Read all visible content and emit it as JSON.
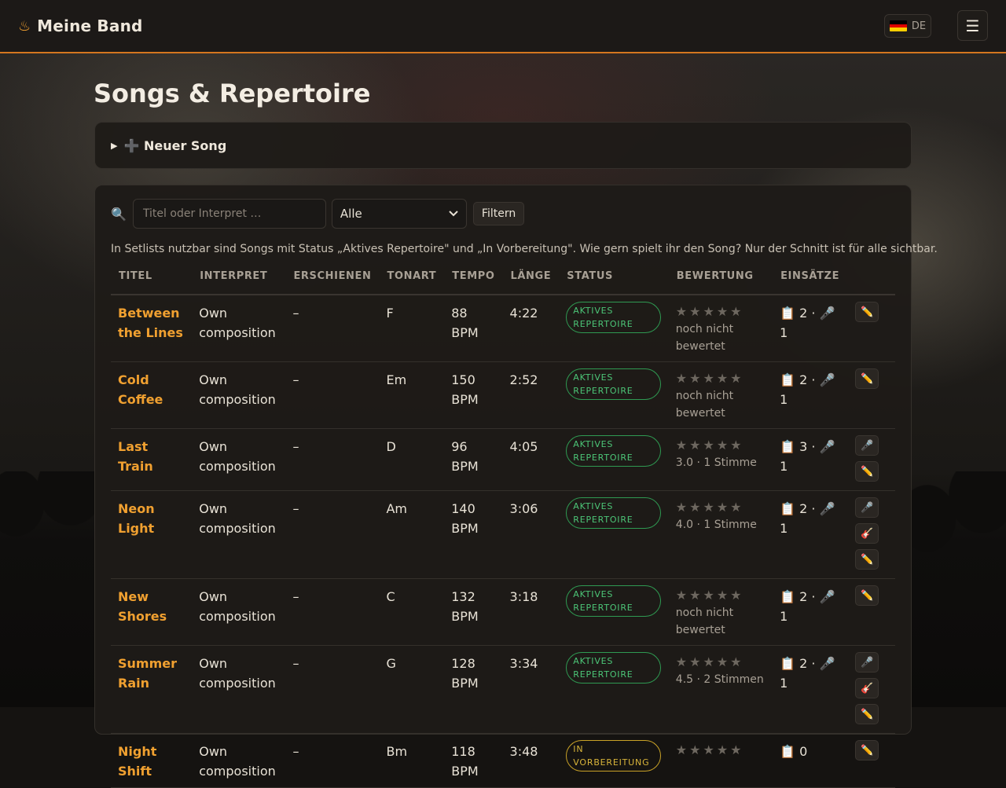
{
  "app": {
    "name": "Meine Band",
    "icon": "flame-icon"
  },
  "language": {
    "code": "DE",
    "flag_colors": [
      "#000000",
      "#dd0000",
      "#ffce00"
    ]
  },
  "menu": {
    "icon": "hamburger-icon",
    "glyph": "☰"
  },
  "page": {
    "title": "Songs & Repertoire"
  },
  "new_song": {
    "label": "➕ Neuer Song",
    "toggle": "▶"
  },
  "filter": {
    "search_placeholder": "Titel oder Interpret …",
    "status_selected": "Alle",
    "button": "Filtern"
  },
  "hint": "In Setlists nutzbar sind Songs mit Status „Aktives Repertoire\" und „In Vorbereitung\". Wie gern spielt ihr den Song? Nur der Schnitt ist für alle sichtbar.",
  "table": {
    "columns": [
      "TITEL",
      "INTERPRET",
      "ERSCHIENEN",
      "TONART",
      "TEMPO",
      "LÄNGE",
      "STATUS",
      "BEWERTUNG",
      "EINSÄTZE",
      ""
    ],
    "rows": [
      {
        "title": "Between the Lines",
        "artist": "Own composition",
        "released": "–",
        "key": "F",
        "tempo": "88 BPM",
        "length": "4:22",
        "status": "AKTIVES REPERTOIRE",
        "stars": "★★★★★",
        "rating": "noch nicht bewertet",
        "usage": "📋 2 · 🎤 1",
        "actions": [
          "✏️"
        ]
      },
      {
        "title": "Cold Coffee",
        "artist": "Own composition",
        "released": "–",
        "key": "Em",
        "tempo": "150 BPM",
        "length": "2:52",
        "status": "AKTIVES REPERTOIRE",
        "stars": "★★★★★",
        "rating": "noch nicht bewertet",
        "usage": "📋 2 · 🎤 1",
        "actions": [
          "✏️"
        ]
      },
      {
        "title": "Last Train",
        "artist": "Own composition",
        "released": "–",
        "key": "D",
        "tempo": "96 BPM",
        "length": "4:05",
        "status": "AKTIVES REPERTOIRE",
        "stars": "★★★★★",
        "rating": "3.0 · 1 Stimme",
        "usage": "📋 3 · 🎤 1",
        "actions": [
          "🎤",
          "✏️"
        ]
      },
      {
        "title": "Neon Light",
        "artist": "Own composition",
        "released": "–",
        "key": "Am",
        "tempo": "140 BPM",
        "length": "3:06",
        "status": "AKTIVES REPERTOIRE",
        "stars": "★★★★★",
        "rating": "4.0 · 1 Stimme",
        "usage": "📋 2 · 🎤 1",
        "actions": [
          "🎤",
          "🎸",
          "✏️"
        ]
      },
      {
        "title": "New Shores",
        "artist": "Own composition",
        "released": "–",
        "key": "C",
        "tempo": "132 BPM",
        "length": "3:18",
        "status": "AKTIVES REPERTOIRE",
        "stars": "★★★★★",
        "rating": "noch nicht bewertet",
        "usage": "📋 2 · 🎤 1",
        "actions": [
          "✏️"
        ]
      },
      {
        "title": "Summer Rain",
        "artist": "Own composition",
        "released": "–",
        "key": "G",
        "tempo": "128 BPM",
        "length": "3:34",
        "status": "AKTIVES REPERTOIRE",
        "stars": "★★★★★",
        "rating": "4.5 · 2 Stimmen",
        "usage": "📋 2 · 🎤 1",
        "actions": [
          "🎤",
          "🎸",
          "✏️"
        ]
      },
      {
        "title": "Night Shift",
        "artist": "Own composition",
        "released": "–",
        "key": "Bm",
        "tempo": "118 BPM",
        "length": "3:48",
        "status": "IN VORBEREITUNG",
        "stars": "★★★★★",
        "rating": "",
        "usage": "📋 0",
        "actions": [
          "✏️"
        ]
      }
    ]
  }
}
